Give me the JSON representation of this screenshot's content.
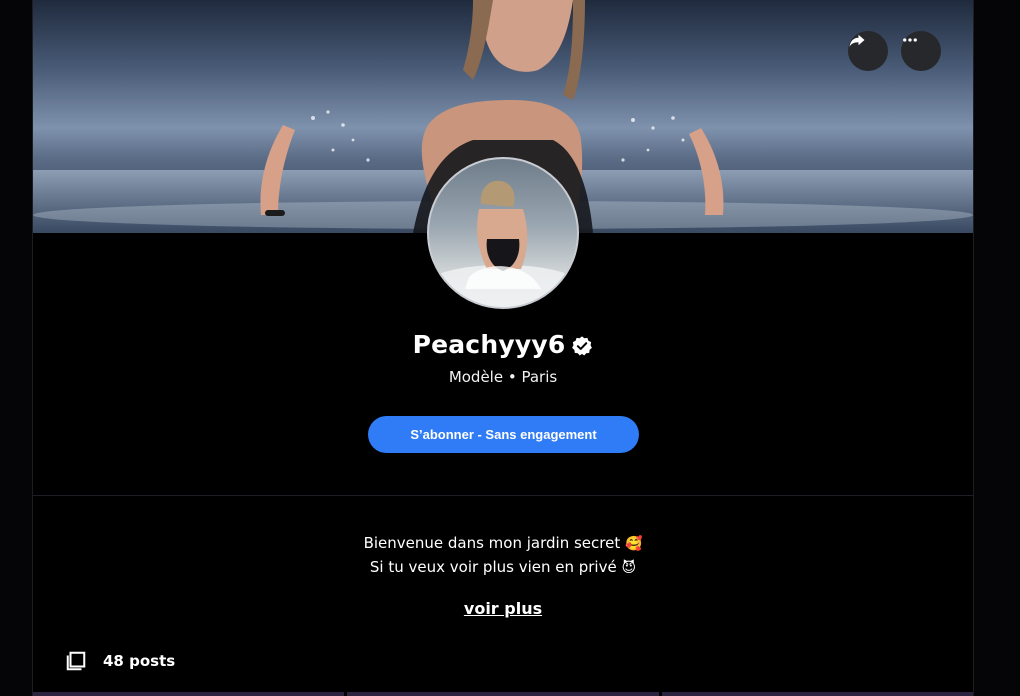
{
  "profile": {
    "name": "Peachyyy6",
    "subtitle": "Modèle • Paris",
    "verified": true
  },
  "actions": {
    "subscribe_label": "S’abonner - Sans engagement",
    "share_icon": "share-icon",
    "more_icon": "more-horizontal-icon"
  },
  "bio": {
    "line1": "Bienvenue dans mon jardin secret",
    "line1_emoji": "🥰",
    "line2": "Si tu veux voir plus vien en privé",
    "line2_emoji": "😈",
    "more_label": "voir plus"
  },
  "stats": {
    "posts_label": "48 posts"
  },
  "colors": {
    "accent": "#2f7cf6",
    "background": "#000000"
  }
}
